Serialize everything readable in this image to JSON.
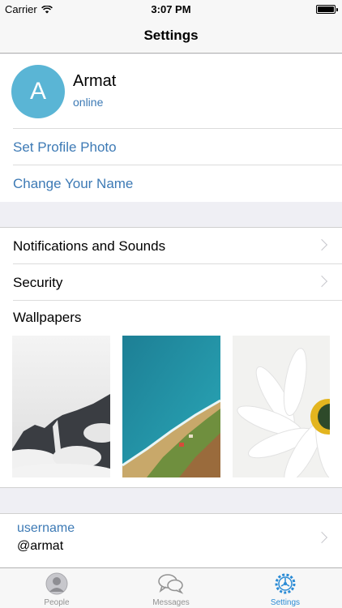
{
  "status_bar": {
    "carrier": "Carrier",
    "time": "3:07 PM"
  },
  "nav": {
    "title": "Settings"
  },
  "profile": {
    "avatar_letter": "A",
    "name": "Armat",
    "status": "online",
    "set_photo": "Set Profile Photo",
    "change_name": "Change Your Name"
  },
  "settings": {
    "notifications": "Notifications and Sounds",
    "security": "Security",
    "wallpapers": "Wallpapers"
  },
  "account": {
    "username_label": "username",
    "username_value": "@armat"
  },
  "tabs": [
    {
      "label": "People",
      "icon": "person-icon",
      "active": false
    },
    {
      "label": "Messages",
      "icon": "chat-bubbles-icon",
      "active": false
    },
    {
      "label": "Settings",
      "icon": "settings-gear-icon",
      "active": true
    }
  ],
  "colors": {
    "accent": "#3d7ab5",
    "avatar_bg": "#5ab5d5",
    "tab_active": "#2a8bd5"
  }
}
